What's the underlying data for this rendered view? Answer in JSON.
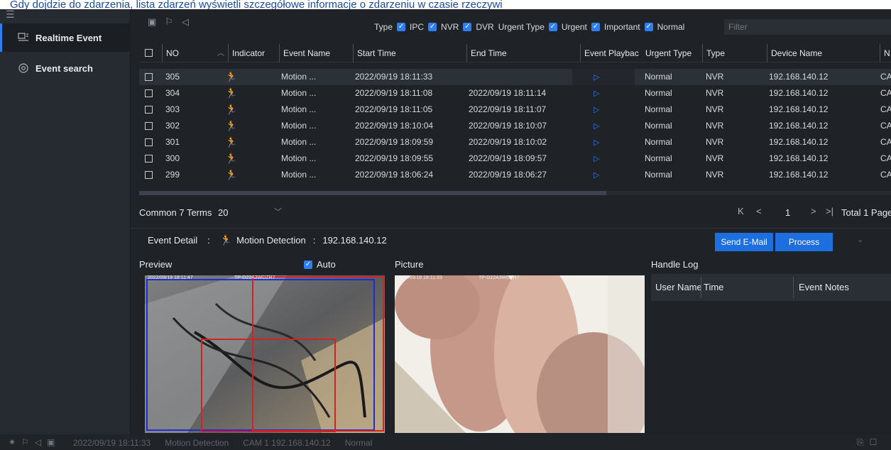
{
  "caption": "Gdy dojdzie do zdarzenia, lista zdarzeń wyświetli szczegółowe informacje o zdarzeniu w czasie rzeczywi",
  "sidebar": {
    "items": [
      {
        "label": "Realtime Event",
        "icon": "realtime-event-icon",
        "active": true
      },
      {
        "label": "Event search",
        "icon": "settings-icon",
        "active": false
      }
    ]
  },
  "filters": {
    "type_label": "Type",
    "types": [
      "IPC",
      "NVR",
      "DVR"
    ],
    "urgent_label": "Urgent Type",
    "urgents": [
      "Urgent",
      "Important",
      "Normal"
    ],
    "filter_placeholder": "Filter"
  },
  "table": {
    "headers": [
      "NO",
      "Indicator",
      "Event Name",
      "Start Time",
      "End Time",
      "Event Playbac",
      "Urgent Type",
      "Type",
      "Device Name",
      "N"
    ],
    "rows": [
      {
        "no": "305",
        "event": "Motion ...",
        "start": "2022/09/19 18:11:33",
        "end": "",
        "urgency": "Normal",
        "type": "NVR",
        "device": "192.168.140.12",
        "n": "CA"
      },
      {
        "no": "304",
        "event": "Motion ...",
        "start": "2022/09/19 18:11:08",
        "end": "2022/09/19 18:11:14",
        "urgency": "Normal",
        "type": "NVR",
        "device": "192.168.140.12",
        "n": "CA"
      },
      {
        "no": "303",
        "event": "Motion ...",
        "start": "2022/09/19 18:11:05",
        "end": "2022/09/19 18:11:07",
        "urgency": "Normal",
        "type": "NVR",
        "device": "192.168.140.12",
        "n": "CA"
      },
      {
        "no": "302",
        "event": "Motion ...",
        "start": "2022/09/19 18:10:04",
        "end": "2022/09/19 18:10:07",
        "urgency": "Normal",
        "type": "NVR",
        "device": "192.168.140.12",
        "n": "CA"
      },
      {
        "no": "301",
        "event": "Motion ...",
        "start": "2022/09/19 18:09:59",
        "end": "2022/09/19 18:10:02",
        "urgency": "Normal",
        "type": "NVR",
        "device": "192.168.140.12",
        "n": "CA"
      },
      {
        "no": "300",
        "event": "Motion ...",
        "start": "2022/09/19 18:09:55",
        "end": "2022/09/19 18:09:57",
        "urgency": "Normal",
        "type": "NVR",
        "device": "192.168.140.12",
        "n": "CA"
      },
      {
        "no": "299",
        "event": "Motion ...",
        "start": "2022/09/19 18:06:24",
        "end": "2022/09/19 18:06:27",
        "urgency": "Normal",
        "type": "NVR",
        "device": "192.168.140.12",
        "n": "CA"
      }
    ]
  },
  "pager": {
    "terms": "Common 7 Terms",
    "page_size": "20",
    "current_page": "1",
    "total": "Total 1 Page"
  },
  "detail": {
    "label": "Event Detail",
    "sep": ":",
    "event": "Motion Detection",
    "sep2": ":",
    "device": "192.168.140.12",
    "send_mail": "Send E-Mail",
    "process": "Process"
  },
  "panels": {
    "preview": "Preview",
    "auto": "Auto",
    "picture": "Picture",
    "handle_log": "Handle Log",
    "handle_cols": [
      "User Name",
      "Time",
      "Event Notes"
    ],
    "preview_stamp": "2022/09/19 18:11:47",
    "preview_device": "TP-D22A3WDZR7",
    "picture_stamp": "2022/09/19 18:11:33",
    "picture_device": "TP-D22A3WDZR7"
  },
  "statusbar": {
    "time": "2022/09/19 18:11:33",
    "event": "Motion Detection",
    "source": "CAM 1 192.168.140.12",
    "urgency": "Normal"
  },
  "colors": {
    "accent": "#2f7ff0",
    "button": "#1d6fe0",
    "background": "#1f2227",
    "sidebar": "#262a31",
    "caption_text": "#1a4c9c"
  }
}
